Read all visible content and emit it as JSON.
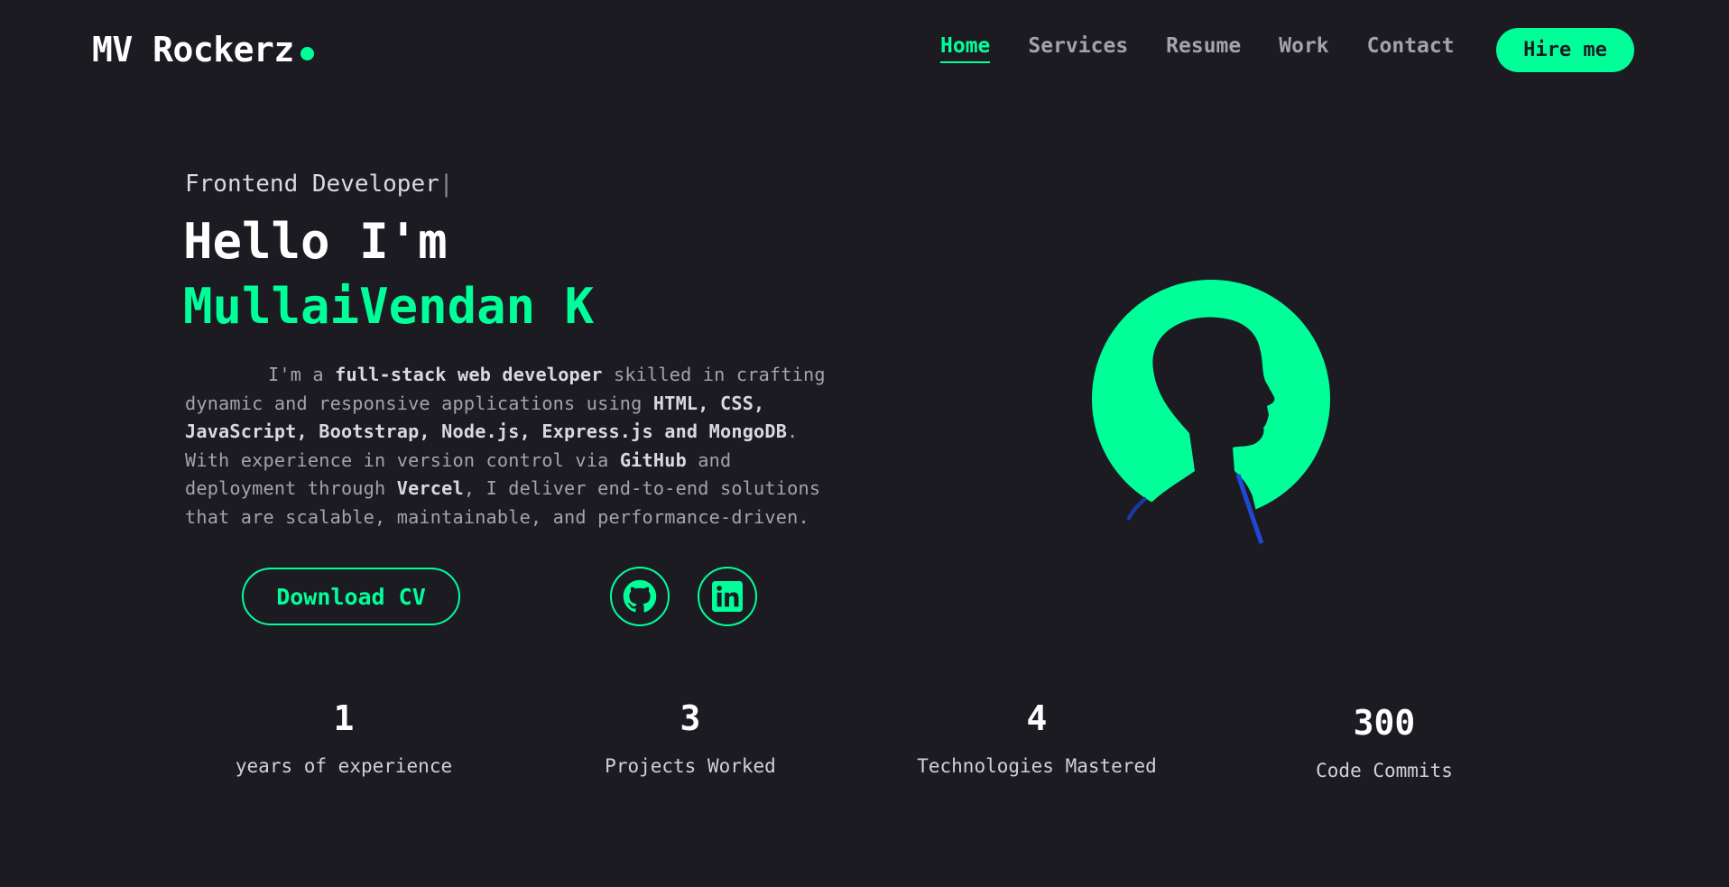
{
  "header": {
    "logo": "MV Rockerz",
    "nav": [
      {
        "label": "Home",
        "active": true
      },
      {
        "label": "Services",
        "active": false
      },
      {
        "label": "Resume",
        "active": false
      },
      {
        "label": "Work",
        "active": false
      },
      {
        "label": "Contact",
        "active": false
      }
    ],
    "hire_label": "Hire me"
  },
  "hero": {
    "role": "Frontend Developer",
    "caret": "|",
    "greeting": "Hello I'm",
    "name": "MullaiVendan K",
    "bio": {
      "p1": "I'm a ",
      "b1": "full-stack web developer",
      "p2": " skilled in crafting dynamic and responsive applications using ",
      "b2": "HTML, CSS, JavaScript, Bootstrap, Node.js, Express.js and MongoDB",
      "p3": ". With experience in version control via ",
      "b3": "GitHub",
      "p4": " and deployment through ",
      "b4": "Vercel",
      "p5": ", I deliver end-to-end solutions that are scalable, maintainable, and performance-driven."
    },
    "cv_label": "Download CV",
    "social": [
      {
        "icon": "github-icon"
      },
      {
        "icon": "linkedin-icon"
      }
    ]
  },
  "stats": [
    {
      "value": "1",
      "label": "years of experience"
    },
    {
      "value": "3",
      "label": "Projects Worked"
    },
    {
      "value": "4",
      "label": "Technologies Mastered"
    },
    {
      "value": "300",
      "label": "Code Commits"
    }
  ],
  "colors": {
    "accent": "#00ff99",
    "background": "#1c1b22",
    "muted_text": "#a3a3ad"
  }
}
